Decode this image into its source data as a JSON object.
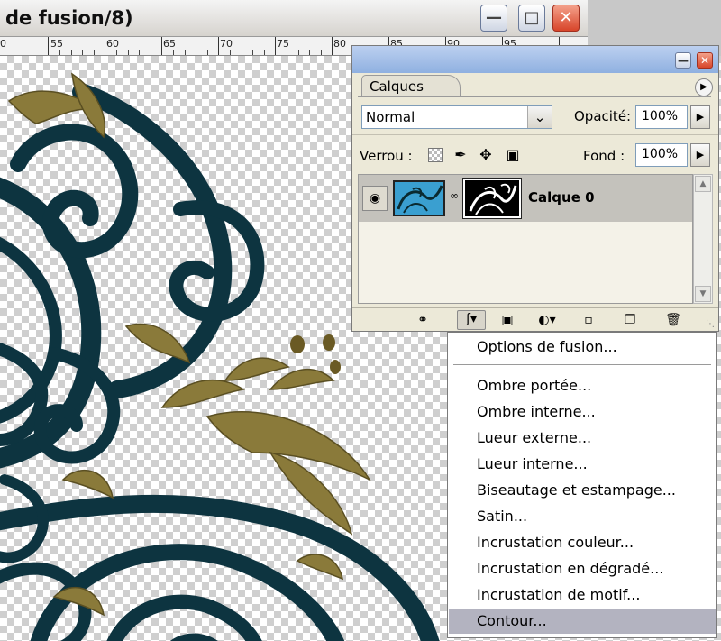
{
  "document": {
    "title": "de fusion/8)",
    "ruler_labels": [
      "0",
      "55",
      "60",
      "65",
      "70",
      "75",
      "80",
      "85",
      "90",
      "95"
    ],
    "window_buttons": [
      "minimize",
      "maximize",
      "close"
    ]
  },
  "layers_panel": {
    "tab": "Calques",
    "blend_mode": "Normal",
    "opacity_label": "Opacité:",
    "opacity_value": "100%",
    "lock_label": "Verrou :",
    "fill_label": "Fond :",
    "fill_value": "100%",
    "layers": [
      {
        "name": "Calque 0",
        "visible": true,
        "has_mask": true,
        "selected": true
      }
    ],
    "bottom_icons": [
      "link-layers-icon",
      "layer-style-fx-icon",
      "add-mask-icon",
      "adjustment-layer-icon",
      "new-group-icon",
      "new-layer-icon",
      "trash-icon"
    ]
  },
  "style_menu": {
    "header_item": "Options de fusion...",
    "items": [
      "Ombre portée...",
      "Ombre interne...",
      "Lueur externe...",
      "Lueur interne...",
      "Biseautage et estampage...",
      "Satin...",
      "Incrustation couleur...",
      "Incrustation en dégradé...",
      "Incrustation de motif...",
      "Contour..."
    ],
    "highlighted": "Contour..."
  },
  "colors": {
    "selection_highlight": "#b3b3c0",
    "panel_bg": "#ece9d8",
    "ironwork_dark": "#0d3440",
    "ironwork_gold": "#8a7a3a"
  }
}
